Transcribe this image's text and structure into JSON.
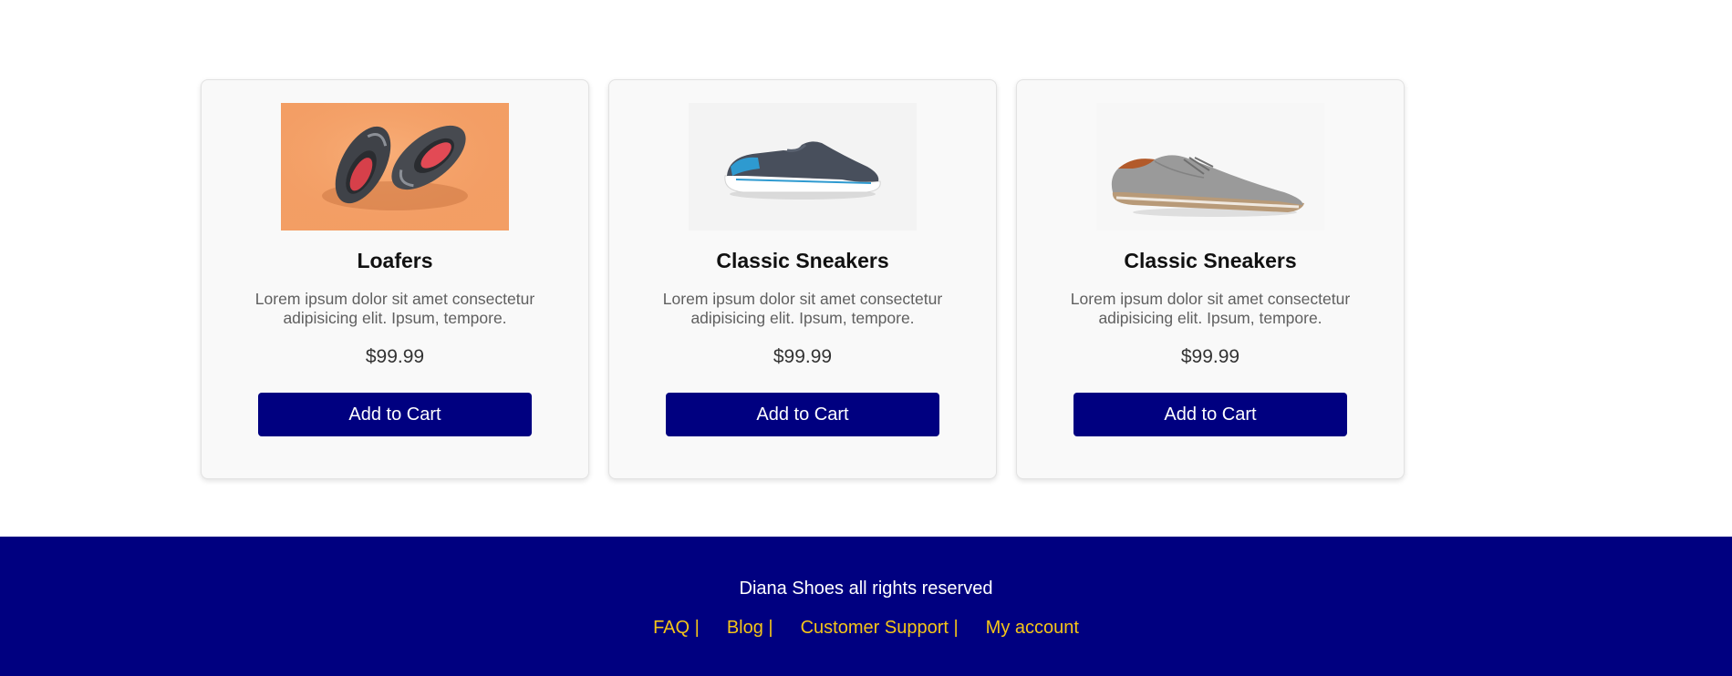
{
  "products": [
    {
      "image": "grey-slip-on-shoes-on-orange-background",
      "title": "Loafers",
      "description": "Lorem ipsum dolor sit amet consectetur adipisicing elit. Ipsum, tempore.",
      "price": "$99.99",
      "button": "Add to Cart"
    },
    {
      "image": "dark-grey-slip-on-sneaker-with-blue-accent",
      "title": "Classic Sneakers",
      "description": "Lorem ipsum dolor sit amet consectetur adipisicing elit. Ipsum, tempore.",
      "price": "$99.99",
      "button": "Add to Cart"
    },
    {
      "image": "grey-suede-lace-up-derby-shoe",
      "title": "Classic Sneakers",
      "description": "Lorem ipsum dolor sit amet consectetur adipisicing elit. Ipsum, tempore.",
      "price": "$99.99",
      "button": "Add to Cart"
    }
  ],
  "footer": {
    "copyright": "Diana Shoes all rights reserved",
    "links": [
      "FAQ |",
      "Blog |",
      "Customer Support |",
      "My account"
    ]
  },
  "colors": {
    "brand": "#000080",
    "link": "#f5c518",
    "card_bg": "#f9f9f9"
  }
}
